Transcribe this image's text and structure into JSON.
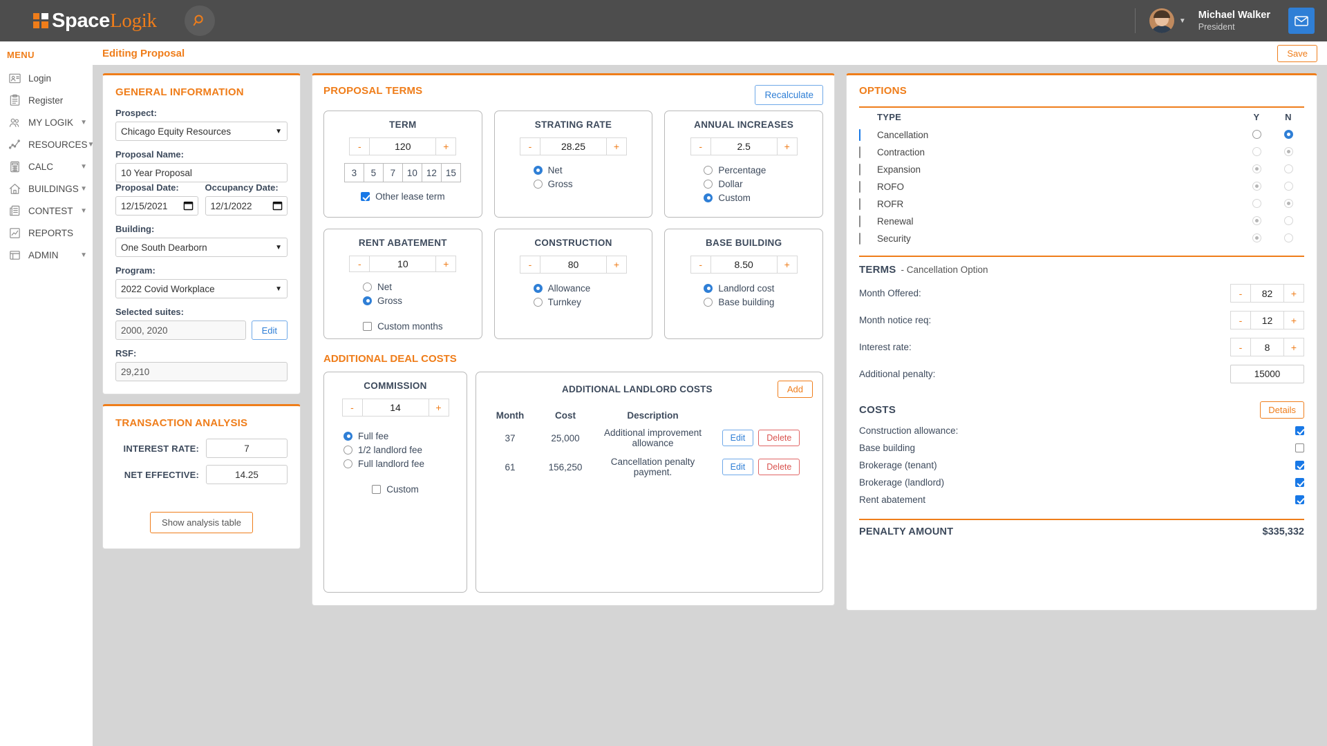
{
  "app": {
    "brand_space": "Space",
    "brand_logik": "Logik",
    "accent": "#ef7d1a",
    "blue": "#2f7fd6"
  },
  "topbar": {
    "search_icon": "search-icon",
    "user_name": "Michael Walker",
    "user_role": "President",
    "mail_icon": "mail-icon",
    "caret_icon": "chevron-down-icon"
  },
  "sidebar": {
    "title": "MENU",
    "items": [
      {
        "label": "Login",
        "icon": "id-card-icon",
        "chevron": false
      },
      {
        "label": "Register",
        "icon": "clipboard-icon",
        "chevron": false
      },
      {
        "label": "MY LOGIK",
        "icon": "users-icon",
        "chevron": true
      },
      {
        "label": "RESOURCES",
        "icon": "line-chart-icon",
        "chevron": true
      },
      {
        "label": "CALC",
        "icon": "calculator-icon",
        "chevron": true
      },
      {
        "label": "BUILDINGS",
        "icon": "home-icon",
        "chevron": true
      },
      {
        "label": "CONTEST",
        "icon": "news-icon",
        "chevron": true
      },
      {
        "label": "REPORTS",
        "icon": "report-icon",
        "chevron": false
      },
      {
        "label": "ADMIN",
        "icon": "admin-icon",
        "chevron": true
      }
    ]
  },
  "page": {
    "title": "Editing Proposal",
    "save_label": "Save"
  },
  "general_information": {
    "heading": "GENERAL INFORMATION",
    "prospect_label": "Prospect:",
    "prospect_value": "Chicago Equity Resources",
    "proposal_name_label": "Proposal Name:",
    "proposal_name_value": "10 Year Proposal",
    "proposal_date_label": "Proposal Date:",
    "proposal_date_value": "12/15/2021",
    "occupancy_date_label": "Occupancy Date:",
    "occupancy_date_value": "12/1/2022",
    "building_label": "Building:",
    "building_value": "One South Dearborn",
    "program_label": "Program:",
    "program_value": "2022 Covid Workplace",
    "selected_suites_label": "Selected suites:",
    "selected_suites_value": "2000, 2020",
    "edit_label": "Edit",
    "rsf_label": "RSF:",
    "rsf_value": "29,210"
  },
  "transaction_analysis": {
    "heading": "TRANSACTION ANALYSIS",
    "interest_rate_label": "INTEREST RATE:",
    "interest_rate_value": "7",
    "net_effective_label": "NET EFFECTIVE:",
    "net_effective_value": "14.25",
    "show_table_label": "Show analysis table"
  },
  "proposal_terms": {
    "heading": "PROPOSAL TERMS",
    "recalculate_label": "Recalculate",
    "minus": "-",
    "plus": "+",
    "tiles": [
      {
        "title": "TERM",
        "value": "120",
        "quick_terms": [
          "3",
          "5",
          "7",
          "10",
          "12",
          "15"
        ],
        "checkbox": {
          "label": "Other lease term",
          "checked": true
        }
      },
      {
        "title": "STRATING RATE",
        "value": "28.25",
        "radios": [
          {
            "label": "Net",
            "selected": true
          },
          {
            "label": "Gross",
            "selected": false
          }
        ]
      },
      {
        "title": "ANNUAL INCREASES",
        "value": "2.5",
        "radios": [
          {
            "label": "Percentage",
            "selected": false
          },
          {
            "label": "Dollar",
            "selected": false
          },
          {
            "label": "Custom",
            "selected": true
          }
        ]
      },
      {
        "title": "RENT ABATEMENT",
        "value": "10",
        "radios": [
          {
            "label": "Net",
            "selected": false
          },
          {
            "label": "Gross",
            "selected": true
          }
        ],
        "checkbox": {
          "label": "Custom months",
          "checked": false
        }
      },
      {
        "title": "CONSTRUCTION",
        "value": "80",
        "radios": [
          {
            "label": "Allowance",
            "selected": true
          },
          {
            "label": "Turnkey",
            "selected": false
          }
        ]
      },
      {
        "title": "BASE BUILDING",
        "value": "8.50",
        "radios": [
          {
            "label": "Landlord cost",
            "selected": true
          },
          {
            "label": "Base building",
            "selected": false
          }
        ]
      }
    ]
  },
  "additional_deal_costs": {
    "heading": "ADDITIONAL DEAL COSTS",
    "commission": {
      "title": "COMMISSION",
      "value": "14",
      "radios": [
        {
          "label": "Full fee",
          "selected": true
        },
        {
          "label": "1/2 landlord fee",
          "selected": false
        },
        {
          "label": "Full landlord fee",
          "selected": false
        }
      ],
      "checkbox": {
        "label": "Custom",
        "checked": false
      }
    },
    "landlord_costs": {
      "title": "ADDITIONAL LANDLORD COSTS",
      "add_label": "Add",
      "columns": [
        "Month",
        "Cost",
        "Description"
      ],
      "edit_label": "Edit",
      "delete_label": "Delete",
      "rows": [
        {
          "month": "37",
          "cost": "25,000",
          "description": "Additional improvement allowance"
        },
        {
          "month": "61",
          "cost": "156,250",
          "description": "Cancellation penalty payment."
        }
      ]
    }
  },
  "options": {
    "heading": "OPTIONS",
    "columns": {
      "type": "TYPE",
      "y": "Y",
      "n": "N"
    },
    "rows": [
      {
        "label": "Cancellation",
        "checked": true,
        "enabled": true,
        "choice": "N"
      },
      {
        "label": "Contraction",
        "checked": false,
        "enabled": false,
        "choice": "N"
      },
      {
        "label": "Expansion",
        "checked": false,
        "enabled": false,
        "choice": "Y"
      },
      {
        "label": "ROFO",
        "checked": false,
        "enabled": false,
        "choice": "Y"
      },
      {
        "label": "ROFR",
        "checked": false,
        "enabled": false,
        "choice": "N"
      },
      {
        "label": "Renewal",
        "checked": false,
        "enabled": false,
        "choice": "Y"
      },
      {
        "label": "Security",
        "checked": false,
        "enabled": false,
        "choice": "Y"
      }
    ]
  },
  "terms_section": {
    "heading": "TERMS",
    "subheading": "- Cancellation Option",
    "rows": [
      {
        "label": "Month Offered:",
        "value": "82",
        "stepper": true
      },
      {
        "label": "Month notice req:",
        "value": "12",
        "stepper": true
      },
      {
        "label": "Interest rate:",
        "value": "8",
        "stepper": true
      },
      {
        "label": "Additional penalty:",
        "value": "15000",
        "stepper": false
      }
    ]
  },
  "costs_section": {
    "heading": "COSTS",
    "details_label": "Details",
    "rows": [
      {
        "label": "Construction allowance:",
        "checked": true
      },
      {
        "label": "Base building",
        "checked": false
      },
      {
        "label": "Brokerage (tenant)",
        "checked": true
      },
      {
        "label": "Brokerage (landlord)",
        "checked": true
      },
      {
        "label": "Rent abatement",
        "checked": true
      }
    ],
    "penalty_label": "PENALTY AMOUNT",
    "penalty_value": "$335,332"
  }
}
